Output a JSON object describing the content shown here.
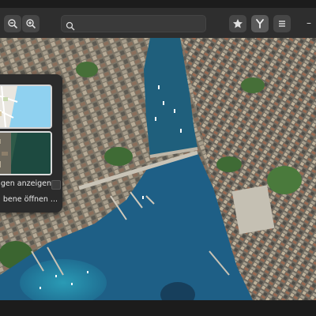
{
  "headerbar": {
    "zoom_out_icon": "zoom-out-icon",
    "zoom_in_icon": "zoom-in-icon",
    "search": {
      "placeholder": "",
      "value": ""
    },
    "favorites_icon": "star-icon",
    "routing_icon": "route-icon",
    "menu_icon": "hamburger-menu-icon",
    "minimize_label": "–"
  },
  "layers_popover": {
    "layers": [
      {
        "name": "street-map",
        "selected": false
      },
      {
        "name": "aerial-map",
        "selected": true
      }
    ],
    "show_scale_label": "gen anzeigen",
    "open_file_label": "bene öffnen ..."
  },
  "colors": {
    "headerbar": "#2e2e2e",
    "popover": "#2b2b2b",
    "water": "#2c6d96",
    "lake": "#1e5f86",
    "city": "#8d8576"
  }
}
